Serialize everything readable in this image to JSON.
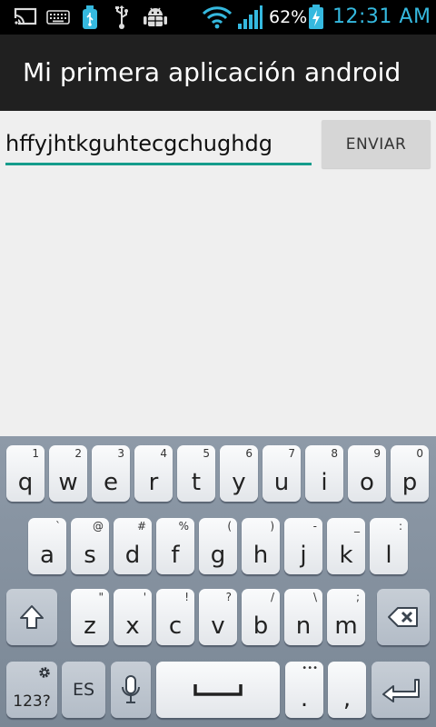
{
  "status_bar": {
    "icons": [
      "cast-icon",
      "keyboard-icon",
      "usb-storage-icon",
      "usb-icon",
      "android-debug-icon",
      "wifi-icon",
      "signal-icon",
      "battery-charging-icon"
    ],
    "battery": "62%",
    "time": "12:31 AM",
    "clock_color": "#35b9df"
  },
  "action_bar": {
    "title": "Mi primera aplicación android"
  },
  "content": {
    "text_field_value": "hffyjhtkguhtecgchughdg",
    "send_button_label": "ENVIAR",
    "accent_color": "#159c8c"
  },
  "keyboard": {
    "row1": [
      {
        "main": "q",
        "sub": "1"
      },
      {
        "main": "w",
        "sub": "2"
      },
      {
        "main": "e",
        "sub": "3"
      },
      {
        "main": "r",
        "sub": "4"
      },
      {
        "main": "t",
        "sub": "5"
      },
      {
        "main": "y",
        "sub": "6"
      },
      {
        "main": "u",
        "sub": "7"
      },
      {
        "main": "i",
        "sub": "8"
      },
      {
        "main": "o",
        "sub": "9"
      },
      {
        "main": "p",
        "sub": "0"
      }
    ],
    "row2": [
      {
        "main": "a",
        "sub": "`"
      },
      {
        "main": "s",
        "sub": "@"
      },
      {
        "main": "d",
        "sub": "#"
      },
      {
        "main": "f",
        "sub": "%"
      },
      {
        "main": "g",
        "sub": "("
      },
      {
        "main": "h",
        "sub": ")"
      },
      {
        "main": "j",
        "sub": "-"
      },
      {
        "main": "k",
        "sub": "_"
      },
      {
        "main": "l",
        "sub": ":"
      }
    ],
    "row3": [
      {
        "main": "z",
        "sub": "\""
      },
      {
        "main": "x",
        "sub": "'"
      },
      {
        "main": "c",
        "sub": "!"
      },
      {
        "main": "v",
        "sub": "?"
      },
      {
        "main": "b",
        "sub": "/"
      },
      {
        "main": "n",
        "sub": "\\"
      },
      {
        "main": "m",
        "sub": ";"
      }
    ],
    "symbols_label": "123?",
    "language_label": "ES",
    "period_label": ".",
    "period_sub": "•••",
    "comma_label": ","
  }
}
